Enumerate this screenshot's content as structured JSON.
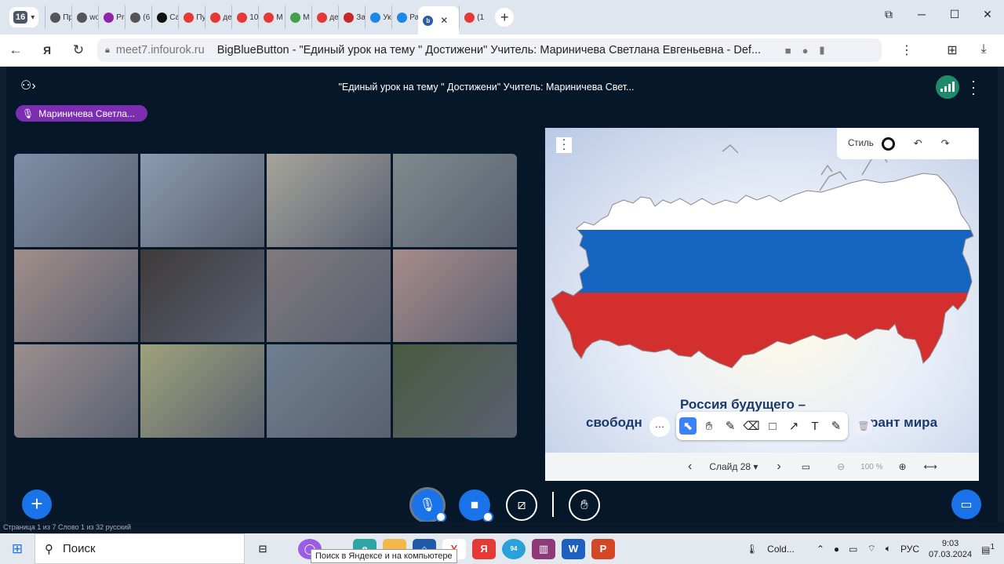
{
  "browser": {
    "tab_count": "16",
    "tabs": [
      {
        "label": "Пр",
        "icon": "doc-icon",
        "color": "#555555"
      },
      {
        "label": "wo",
        "icon": "doc-icon",
        "color": "#555555"
      },
      {
        "label": "Pri",
        "icon": "sparkle-icon",
        "color": "#8e24aa"
      },
      {
        "label": "(6",
        "icon": "doc-icon",
        "color": "#555555"
      },
      {
        "label": "Са",
        "icon": "compass-icon",
        "color": "#111111"
      },
      {
        "label": "Пу",
        "icon": "arrow-icon",
        "color": "#e53935"
      },
      {
        "label": "де",
        "icon": "yandex-icon",
        "color": "#e53935"
      },
      {
        "label": "10",
        "icon": "youtube-icon",
        "color": "#e53935"
      },
      {
        "label": "М",
        "icon": "yandex-icon",
        "color": "#e53935"
      },
      {
        "label": "М",
        "icon": "hd-icon",
        "color": "#43a047"
      },
      {
        "label": "де",
        "icon": "yandex-icon",
        "color": "#e53935"
      },
      {
        "label": "За",
        "icon": "lips-icon",
        "color": "#c62828"
      },
      {
        "label": "Ук",
        "icon": "at-icon",
        "color": "#1e88e5"
      },
      {
        "label": "Ра",
        "icon": "mail-icon",
        "color": "#1e88e5"
      }
    ],
    "active_tab": {
      "icon": "bigbluebutton-icon",
      "color": "#2a5caa",
      "label": "b"
    },
    "last_tab": {
      "label": "(1",
      "icon": "youtube-icon",
      "color": "#e53935"
    },
    "url_domain": "meet7.infourok.ru",
    "page_title": "BigBlueButton - \"Единый урок на тему \" Достижени\" Учитель: Мариничева Светлана Евгеньевна - Def..."
  },
  "meeting": {
    "title": "\"Единый урок на тему \" Достижени\" Учитель: Мариничева Свет...",
    "talking_user": "Мариничева Светла...",
    "video_tiles": 12
  },
  "presentation": {
    "style_label": "Стиль",
    "slide_title": "Россия будущего –",
    "slide_subtitle_left": "свободн",
    "slide_subtitle_right": "рант мира",
    "slide_label": "Слайд 28",
    "zoom": "100 %",
    "flag_colors": {
      "white": "#ffffff",
      "blue": "#1565c0",
      "red": "#d32f2f"
    }
  },
  "taskbar": {
    "search_placeholder": "Поиск",
    "tooltip": "Поиск в Яндексе и на компьютере",
    "weather": "Cold...",
    "language": "РУС",
    "time": "9:03",
    "date": "07.03.2024",
    "notifications": "1",
    "telegram_badge": "94"
  },
  "status_strip": "Страница 1 из 7     Слово 1 из 32     русский"
}
